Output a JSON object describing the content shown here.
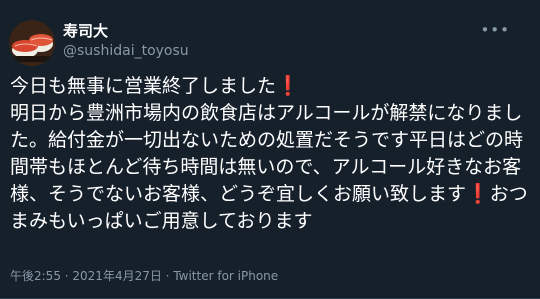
{
  "author": {
    "display_name": "寿司大",
    "handle": "@sushidai_toyosu",
    "avatar": "sushi-avatar"
  },
  "more_icon": "more-options-icon",
  "tweet": {
    "line1": "今日も無事に営業終了しました",
    "line1_emoji": "❗",
    "line2": "明日から豊洲市場内の飲食店はアルコールが解禁になりました。給付金が一切出ないための処置だそうです平日はどの時間帯もほとんど待ち時間は無いので、アルコール好きなお客様、そうでないお客様、どうぞ宜しくお願い致します",
    "line2_emoji": "❗",
    "line3": "おつまみもいっぱいご用意しております"
  },
  "meta": {
    "time": "午後2:55",
    "separator1": " · ",
    "date": "2021年4月27日",
    "separator2": " · ",
    "source": "Twitter for iPhone"
  },
  "colors": {
    "background": "#15202b",
    "text": "#ffffff",
    "secondary": "#8899a6",
    "emoji": "#e0245e"
  }
}
